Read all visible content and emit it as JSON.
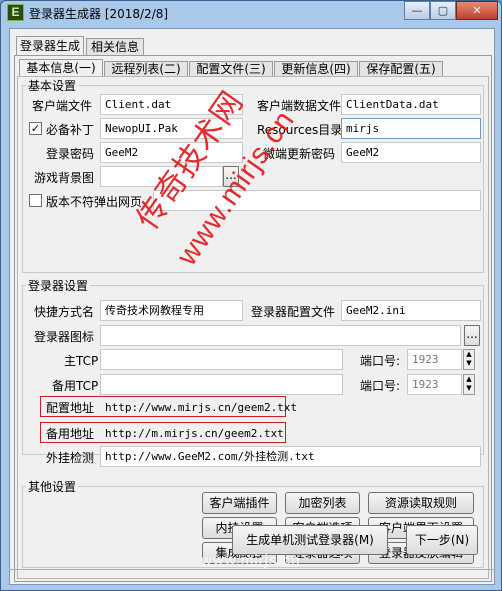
{
  "window": {
    "title": "登录器生成器 [2018/2/8]",
    "icon_letter": "E",
    "minimize": "—",
    "maximize": "▢",
    "close": "✕"
  },
  "top_tabs": [
    "登录器生成",
    "相关信息"
  ],
  "sub_tabs": [
    "基本信息(一)",
    "远程列表(二)",
    "配置文件(三)",
    "更新信息(四)",
    "保存配置(五)"
  ],
  "basic": {
    "group_title": "基本设置",
    "client_file_label": "客户端文件",
    "client_file_value": "Client.dat",
    "client_data_label": "客户端数据文件",
    "client_data_value": "ClientData.dat",
    "required_patch_label": "必备补丁",
    "required_patch_checked": true,
    "required_patch_value": "NewopUI.Pak",
    "resources_label": "Resources目录",
    "resources_value": "mirjs",
    "login_pwd_label": "登录密码",
    "login_pwd_value": "GeeM2",
    "update_pwd_label": "微端更新密码",
    "update_pwd_value": "GeeM2",
    "bg_label": "游戏背景图",
    "bg_browse": "...",
    "version_label": "版本不符弹出网页",
    "version_checked": false
  },
  "login": {
    "group_title": "登录器设置",
    "shortcut_label": "快捷方式名",
    "shortcut_value": "传奇技术网教程专用",
    "config_label": "登录器配置文件",
    "config_value": "GeeM2.ini",
    "icon_label": "登录器图标",
    "icon_browse": "...",
    "main_tcp_label": "主TCP",
    "backup_tcp_label": "备用TCP",
    "port_label": "端口号:",
    "main_port": "1923",
    "backup_port": "1923",
    "config_addr_label": "配置地址",
    "config_addr_value": "http://www.mirjs.cn/geem2.txt",
    "backup_addr_label": "备用地址",
    "backup_addr_value": "http://m.mirjs.cn/geem2.txt",
    "plugin_check_label": "外挂检测",
    "plugin_check_value": "http://www.GeeM2.com/外挂检测.txt"
  },
  "other": {
    "group_title": "其他设置",
    "buttons": [
      [
        "客户端插件",
        "加密列表",
        "资源读取规则"
      ],
      [
        "内挂设置",
        "客户端选项",
        "客户端界面设置"
      ],
      [
        "集成配置",
        "登录器选项",
        "登录器皮肤编辑"
      ]
    ]
  },
  "actions": {
    "generate": "生成单机测试登录器(M)",
    "next": "下一步(N)"
  },
  "watermark": {
    "line1": "传奇技术网",
    "line2": "www.mirjs.cn",
    "bottom": "www.mirjs.cn"
  }
}
